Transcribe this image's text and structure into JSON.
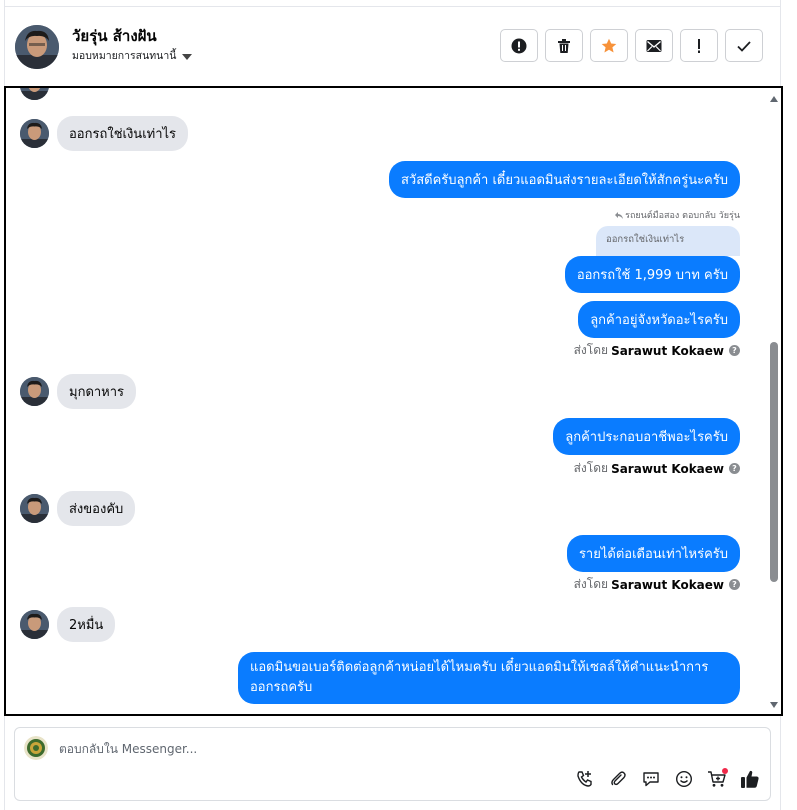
{
  "contact": {
    "name": "วัยรุ่น ส้างฝัน",
    "assign_label": "มอบหมายการสนทนานี้"
  },
  "toolbar": {
    "buttons": [
      {
        "icon": "alert-circle-icon",
        "action": "mark-spam"
      },
      {
        "icon": "trash-icon",
        "action": "delete"
      },
      {
        "icon": "star-icon",
        "action": "star",
        "color": "#f7923a"
      },
      {
        "icon": "envelope-icon",
        "action": "mark-unread"
      },
      {
        "icon": "exclamation-icon",
        "action": "follow-up"
      },
      {
        "icon": "checkmark-icon",
        "action": "done"
      }
    ]
  },
  "messages": [
    {
      "direction": "in",
      "text": "ออกรถใช่เงินเท่าไร"
    },
    {
      "direction": "out",
      "text": "สวัสดีครับลูกค้า เดี๋ยวแอดมินส่งรายละเอียดให้สักครู่นะครับ"
    },
    {
      "direction": "out",
      "reply_meta": "รถยนต์มือสอง ตอบกลับ วัยรุ่น",
      "quoted": "ออกรถใช่เงินเท่าไร",
      "text": "ออกรถใช้ 1,999 บาท ครับ"
    },
    {
      "direction": "out",
      "text": "ลูกค้าอยู่จังหวัดอะไรครับ",
      "sent_by_label": "ส่งโดย",
      "sent_by_name": "Sarawut Kokaew"
    },
    {
      "direction": "in",
      "text": "มุกดาหาร"
    },
    {
      "direction": "out",
      "text": "ลูกค้าประกอบอาชีพอะไรครับ",
      "sent_by_label": "ส่งโดย",
      "sent_by_name": "Sarawut Kokaew"
    },
    {
      "direction": "in",
      "text": "ส่งของคับ"
    },
    {
      "direction": "out",
      "text": "รายได้ต่อเดือนเท่าไหร่ครับ",
      "sent_by_label": "ส่งโดย",
      "sent_by_name": "Sarawut Kokaew"
    },
    {
      "direction": "in",
      "text": "2หมื่น"
    },
    {
      "direction": "out",
      "text": "แอดมินขอเบอร์ติดต่อลูกค้าหน่อยได้ไหมครับ เดี๋ยวแอดมินให้เซลล์ให้คำแนะนำการออกรถครับ"
    }
  ],
  "composer": {
    "placeholder": "ตอบกลับใน Messenger...",
    "value": "",
    "tools": [
      "phone-add-icon",
      "paperclip-icon",
      "chat-bubble-icon",
      "smiley-icon",
      "cart-add-icon",
      "thumbs-up-icon"
    ]
  },
  "colors": {
    "outgoing_bubble": "#0a7cff",
    "incoming_bubble": "#e4e6eb",
    "star": "#f7923a",
    "notification_dot": "#f02849"
  }
}
